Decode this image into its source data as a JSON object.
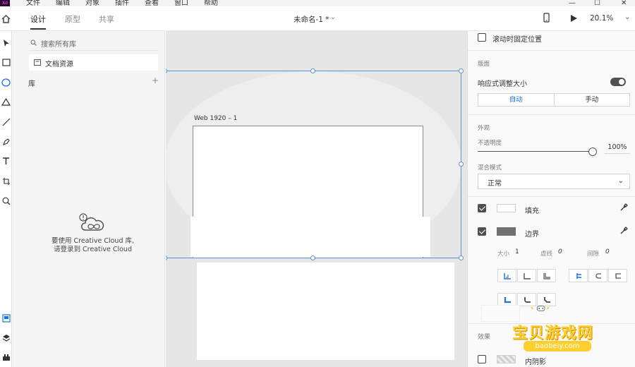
{
  "menubar": {
    "logo": "Xd",
    "items": [
      "文件",
      "编辑",
      "对象",
      "插件",
      "查看",
      "窗口",
      "帮助"
    ]
  },
  "toolbar": {
    "tabs": [
      {
        "label": "设计",
        "active": true
      },
      {
        "label": "原型",
        "active": false
      },
      {
        "label": "共享",
        "active": false
      }
    ],
    "doc_title": "未命名-1 *",
    "zoom": "20.1%"
  },
  "tools": [
    "select-tool-icon",
    "rectangle-tool-icon",
    "ellipse-tool-icon",
    "triangle-tool-icon",
    "line-tool-icon",
    "pen-tool-icon",
    "text-tool-icon",
    "artboard-tool-icon",
    "zoom-tool-icon"
  ],
  "library": {
    "search_placeholder": "搜索所有库",
    "doc_assets": "文档资源",
    "lib_label": "库",
    "cc_message_line1": "要使用 Creative Cloud 库,",
    "cc_message_line2": "请登录到 Creative Cloud"
  },
  "canvas": {
    "artboard_name": "Web 1920 – 1"
  },
  "props": {
    "fix_position": "滚动时固定位置",
    "section_layout": "版面",
    "responsive_resize": "响应式调整大小",
    "responsive_on": true,
    "seg_auto": "自动",
    "seg_manual": "手动",
    "section_appearance": "外观",
    "opacity_label": "不透明度",
    "opacity_value": "100%",
    "opacity_fraction": 1.0,
    "blend_label": "混合模式",
    "blend_value": "正常",
    "fill_label": "填充",
    "fill_enabled": true,
    "fill_color": "#ffffff",
    "border_label": "边界",
    "border_enabled": true,
    "border_color": "#707070",
    "size_label": "大小",
    "size_value": "1",
    "dash_label": "虚线",
    "dash_value": "0",
    "gap_label": "间隙",
    "gap_value": "0",
    "section_effects": "效果",
    "inner_shadow_label": "内阴影"
  },
  "watermark": {
    "title": "宝贝游戏网",
    "url": "baobeiy.com"
  }
}
